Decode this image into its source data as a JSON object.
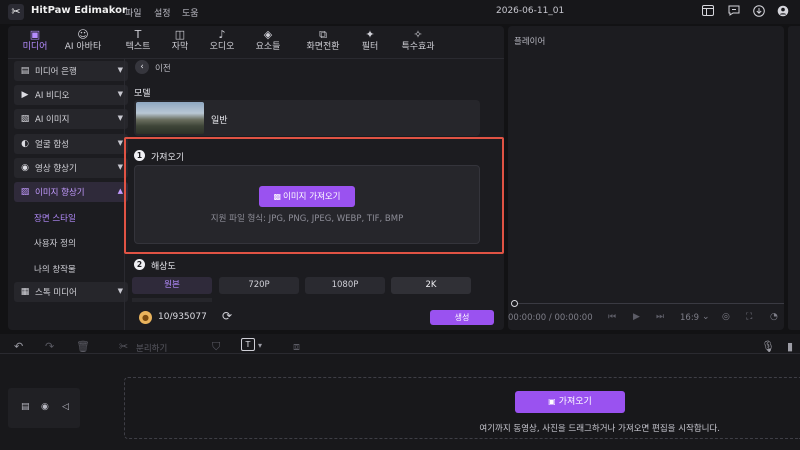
{
  "app": {
    "logo_glyph": "✂",
    "name": "HitPaw Edimakor",
    "menu": [
      "파일",
      "설정",
      "도움"
    ],
    "doc_title": "2026-06-11_01"
  },
  "titlebar_icons": [
    "layout-icon",
    "feedback-icon",
    "download-icon",
    "account-icon"
  ],
  "tabs": [
    {
      "label": "미디어",
      "icon": "media-icon",
      "active": true
    },
    {
      "label": "AI 아바타",
      "icon": "ai-avatar-icon"
    },
    {
      "label": "텍스트",
      "icon": "text-icon"
    },
    {
      "label": "자막",
      "icon": "subtitle-icon"
    },
    {
      "label": "오디오",
      "icon": "audio-icon"
    },
    {
      "label": "요소들",
      "icon": "elements-icon"
    },
    {
      "label": "화면전환",
      "icon": "transition-icon"
    },
    {
      "label": "필터",
      "icon": "filter-icon"
    },
    {
      "label": "특수효과",
      "icon": "effects-icon"
    }
  ],
  "sidebar": {
    "items": [
      {
        "label": "미디어 은행",
        "icon": "media-bank-icon"
      },
      {
        "label": "AI 비디오",
        "icon": "ai-video-icon"
      },
      {
        "label": "AI  이미지",
        "icon": "ai-image-icon"
      },
      {
        "label": "얼굴 합성",
        "icon": "face-swap-icon"
      },
      {
        "label": "영상 향상기",
        "icon": "video-enhancer-icon"
      },
      {
        "label": "이미지 향상기",
        "icon": "image-enhancer-icon",
        "open": true
      },
      {
        "label": "스톡 미디어",
        "icon": "stock-media-icon"
      }
    ],
    "subitems": [
      {
        "label": "장면 스타일",
        "active": true
      },
      {
        "label": "사용자 정의"
      },
      {
        "label": "나의 창작물"
      }
    ]
  },
  "content": {
    "back_label": "이전",
    "model_label": "모델",
    "model_name": "일반",
    "import_step_num": "1",
    "import_step_label": "가져오기",
    "import_button": "이미지 가져오기",
    "supported_formats": "지원 파일 형식: JPG, PNG, JPEG, WEBP, TIF, BMP",
    "resolution_step_num": "2",
    "resolution_label": "해상도",
    "resolutions": [
      "원본",
      "720P",
      "1080P",
      "2K"
    ],
    "selected_resolution": "원본",
    "credits": "10/935077",
    "generate_button": "생성"
  },
  "player": {
    "label": "플레이어",
    "time": "00:00:00 / 00:00:00",
    "ratio": "16:9"
  },
  "timeline": {
    "split_label": "분리하기",
    "import_button": "가져오기",
    "drop_hint": "여기까지 동영상, 사진을 드래그하거나 가져오면 편집을 시작합니다."
  },
  "colors": {
    "accent": "#9a52f0",
    "highlight": "#e05344",
    "panel": "#1c1c20",
    "background": "#121214"
  }
}
